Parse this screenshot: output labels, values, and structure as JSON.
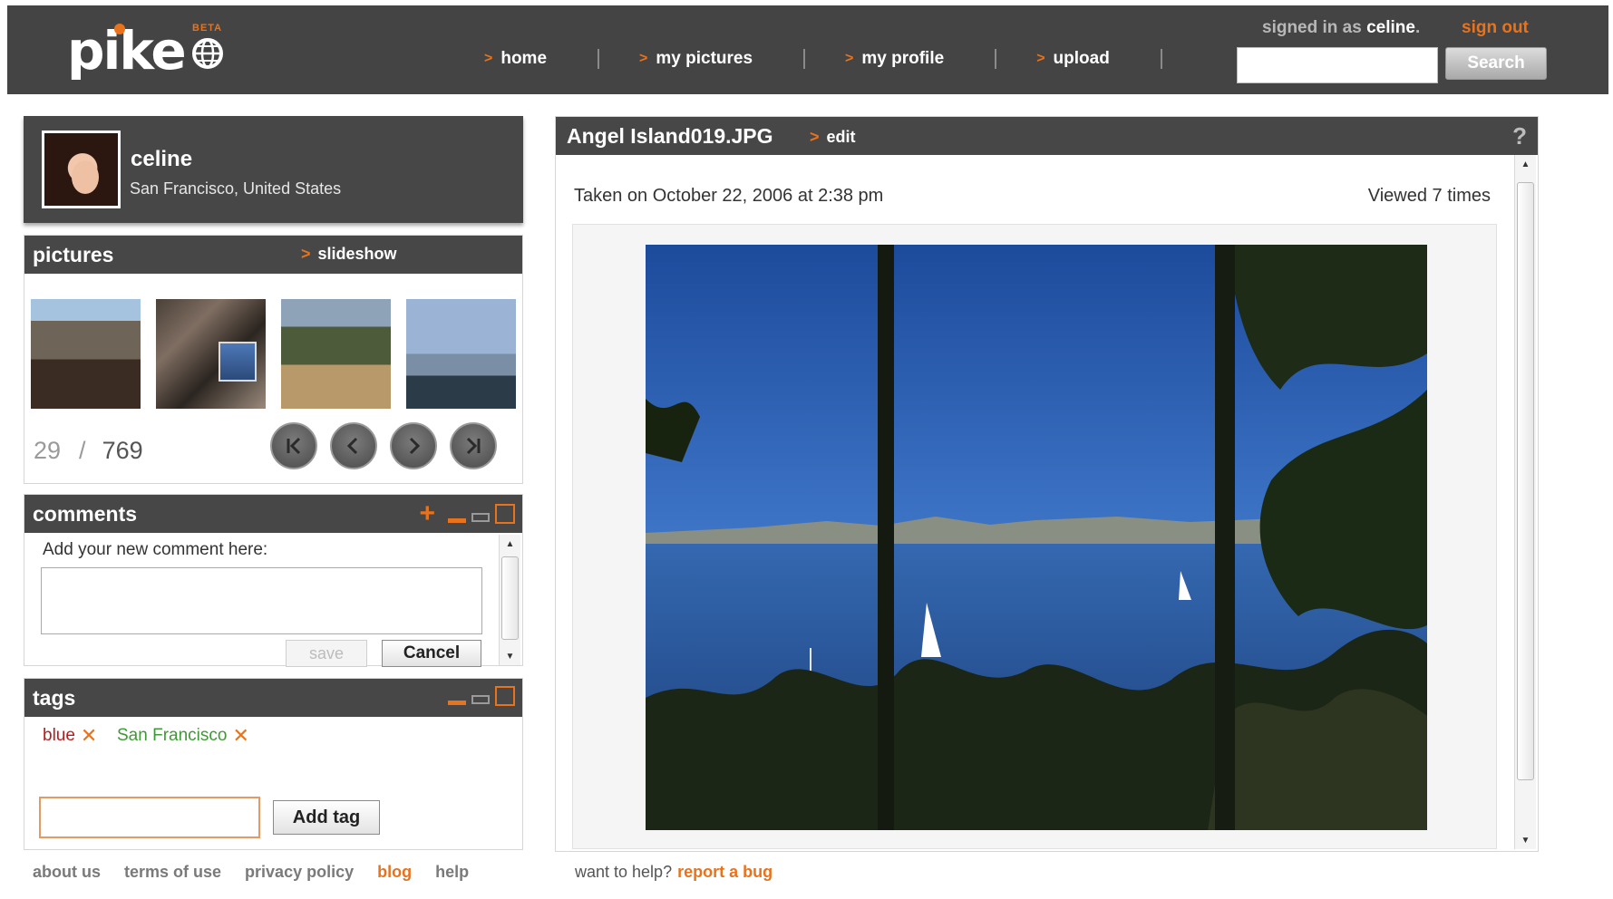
{
  "app": {
    "brand": "pike",
    "beta_label": "BETA"
  },
  "header": {
    "nav": [
      {
        "label": "home"
      },
      {
        "label": "my pictures"
      },
      {
        "label": "my profile"
      },
      {
        "label": "upload"
      }
    ],
    "signed_in_prefix": "signed in as",
    "signed_in_user": "celine",
    "signed_in_suffix": ".",
    "sign_out": "sign out",
    "search_placeholder": "",
    "search_button": "Search"
  },
  "profile": {
    "name": "celine",
    "location": "San Francisco, United States"
  },
  "pictures": {
    "title": "pictures",
    "slideshow": "slideshow",
    "current": "29",
    "separator": "/",
    "total": "769"
  },
  "comments": {
    "title": "comments",
    "label": "Add your new comment here:",
    "save": "save",
    "cancel": "Cancel"
  },
  "tags": {
    "title": "tags",
    "items": [
      {
        "label": "blue",
        "color": "#b81d1d"
      },
      {
        "label": "San Francisco",
        "color": "#3f9a35"
      }
    ],
    "add_button": "Add tag"
  },
  "footer": {
    "links": [
      "about us",
      "terms of use",
      "privacy policy",
      "blog",
      "help"
    ],
    "help_prompt": "want to help?",
    "report_bug": "report a bug"
  },
  "photo": {
    "filename": "Angel Island019.JPG",
    "edit": "edit",
    "help": "?",
    "taken": "Taken on October 22, 2006 at 2:38 pm",
    "viewed": "Viewed 7 times"
  },
  "colors": {
    "header_bg": "#444444",
    "accent": "#e8731c"
  }
}
